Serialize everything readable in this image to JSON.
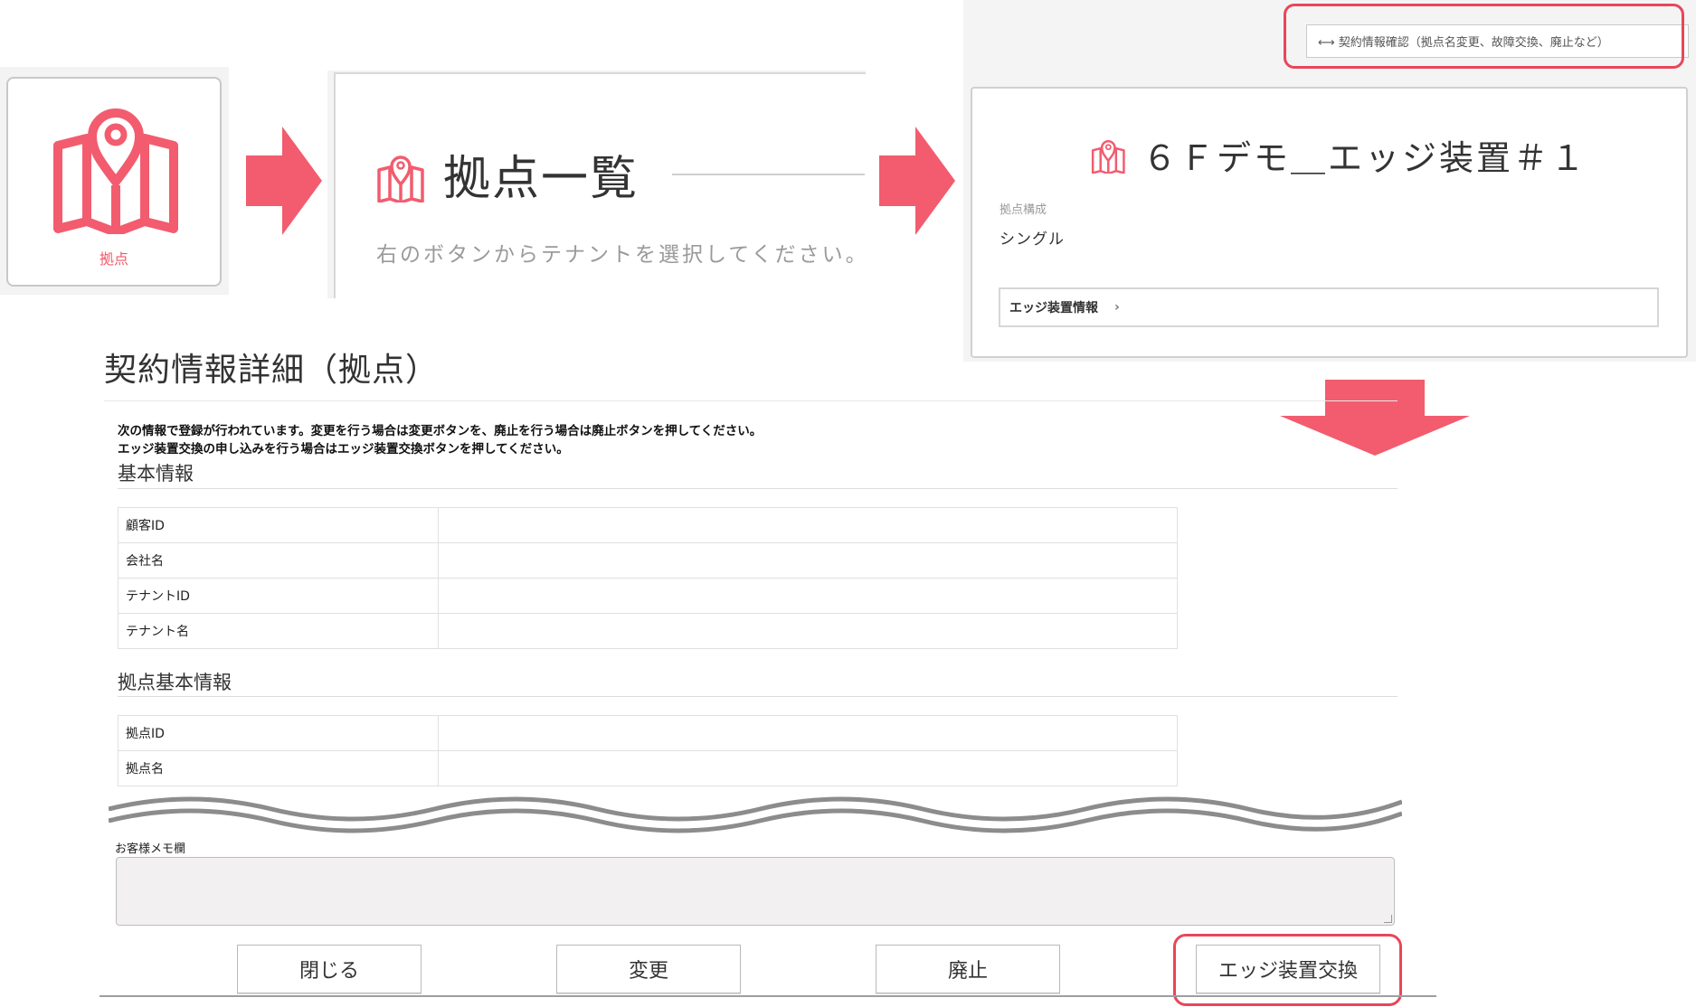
{
  "step1": {
    "tile_label": "拠点",
    "icon": "map-pin-icon"
  },
  "step2": {
    "title": "拠点一覧",
    "subtitle": "右のボタンからテナントを選択してください。",
    "icon": "map-pin-icon"
  },
  "step3": {
    "contract_link": "⟷ 契約情報確認（拠点名変更、故障交換、廃止など）",
    "device_title": "６Ｆデモ＿エッジ装置＃１",
    "config_label": "拠点構成",
    "config_value": "シングル",
    "edge_info_button": "エッジ装置情報",
    "icon": "map-pin-icon"
  },
  "form": {
    "title": "契約情報詳細（拠点）",
    "notice_line1": "次の情報で登録が行われています。変更を行う場合は変更ボタンを、廃止を行う場合は廃止ボタンを押してください。",
    "notice_line2": "エッジ装置交換の申し込みを行う場合はエッジ装置交換ボタンを押してください。",
    "basic_info": {
      "heading": "基本情報",
      "rows": [
        {
          "key": "顧客ID",
          "value": ""
        },
        {
          "key": "会社名",
          "value": ""
        },
        {
          "key": "テナントID",
          "value": ""
        },
        {
          "key": "テナント名",
          "value": ""
        }
      ]
    },
    "site_info": {
      "heading": "拠点基本情報",
      "rows": [
        {
          "key": "拠点ID",
          "value": ""
        },
        {
          "key": "拠点名",
          "value": ""
        }
      ]
    },
    "memo_label": "お客様メモ欄",
    "memo_value": "",
    "buttons": {
      "close": "閉じる",
      "change": "変更",
      "abolish": "廃止",
      "edge_replace": "エッジ装置交換"
    }
  },
  "colors": {
    "accent": "#f25c6e",
    "highlight": "#e8465a"
  }
}
